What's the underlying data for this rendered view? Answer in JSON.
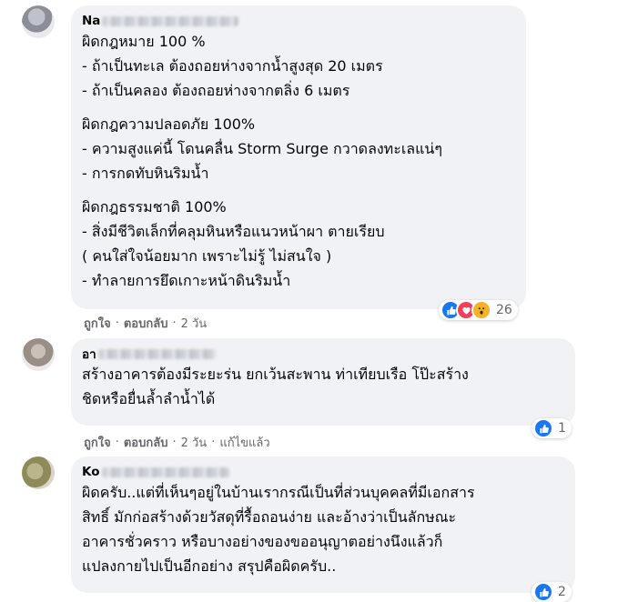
{
  "comments": [
    {
      "name_visible": "Na",
      "lines": [
        "ผิดกฎหมาย 100 %",
        "- ถ้าเป็นทะเล ต้องถอยห่างจากน้ำสูงสุด 20 เมตร",
        "- ถ้าเป็นคลอง ต้องถอยห่างจากตลิ่ง 6 เมตร",
        "",
        "ผิดกฎความปลอดภัย 100%",
        "- ความสูงแค่นี้ โดนคลื่น Storm Surge กวาดลงทะเลแน่ๆ",
        "- การกดทับหินริมน้ำ",
        "",
        "ผิดกฎธรรมชาติ 100%",
        "- สิ่งมีชีวิตเล็กที่คลุมหินหรือแนวหน้าผา ตายเรียบ",
        "( คนใส่ใจน้อยมาก เพราะไม่รู้ ไม่สนใจ )",
        "- ทำลายการยึดเกาะหน้าดินริมน้ำ"
      ],
      "reactions": [
        "like-icon",
        "love-icon",
        "wow-icon"
      ],
      "reaction_count": "26",
      "like_label": "ถูกใจ",
      "reply_label": "ตอบกลับ",
      "time": "2 วัน"
    },
    {
      "name_visible": "อา",
      "lines": [
        "สร้างอาคารต้องมีระยะร่น ยกเว้นสะพาน ท่าเทียบเรือ โป๊ะสร้าง",
        "ชิดหรือยื่นล้ำลำน้ำได้"
      ],
      "reactions": [
        "like-icon"
      ],
      "reaction_count": "1",
      "like_label": "ถูกใจ",
      "reply_label": "ตอบกลับ",
      "time": "2 วัน",
      "edited_label": "แก้ไขแล้ว"
    },
    {
      "name_visible": "Ko",
      "lines": [
        "ผิดครับ..แต่ที่เห็นๆอยู่ในบ้านเรากรณีเป็นที่ส่วนบุคคลที่มีเอกสาร",
        "สิทธิ์ มักก่อสร้างด้วยวัสดุที่รื้อถอนง่าย และอ้างว่าเป็นลักษณะ",
        "อาคารชั่วคราว หรือบางอย่างของขออนุญาตอย่างนึงแล้วก็",
        "แปลงกายไปเป็นอีกอย่าง สรุปคือผิดครับ.."
      ],
      "reactions": [
        "like-icon"
      ],
      "reaction_count": "2"
    }
  ],
  "colors": {
    "bubble": "#f0f2f5",
    "meta_text": "#65676b",
    "like_blue": "#1877f2",
    "love_red": "#f33e58",
    "wow_yellow": "#f7b125"
  }
}
